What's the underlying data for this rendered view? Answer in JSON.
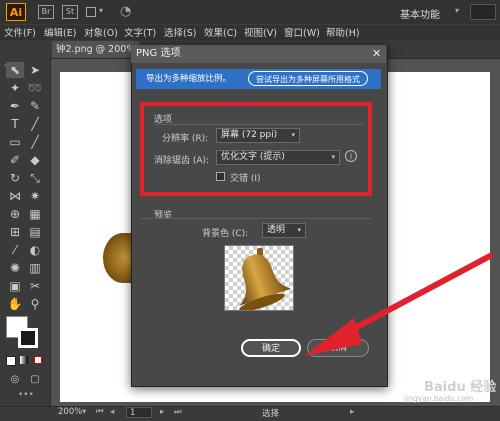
{
  "app": {
    "logo_text": "Ai",
    "bar_icons": [
      "Br",
      "St"
    ],
    "workspace_label": "基本功能",
    "colors": {
      "accent": "#ff9a00",
      "info_bar": "#2e72c8",
      "highlight": "#e0222c",
      "arrow": "#e0222c"
    }
  },
  "menu": {
    "items": [
      "文件(F)",
      "编辑(E)",
      "对象(O)",
      "文字(T)",
      "选择(S)",
      "效果(C)",
      "视图(V)",
      "窗口(W)",
      "帮助(H)"
    ]
  },
  "document": {
    "tab_label": "钟2.png @ 200%"
  },
  "dialog": {
    "title": "PNG 选项",
    "info_text": "导出为多种缩放比例。",
    "info_button": "尝试导出为多种屏幕所用格式",
    "options_group": "选项",
    "resolution_label": "分辨率 (R):",
    "resolution_value": "屏幕 (72 ppi)",
    "antialias_label": "消除锯齿 (A):",
    "antialias_value": "优化文字 (提示)",
    "interlace_label": "交错 (I)",
    "interlace_checked": false,
    "preview_group": "预览",
    "bg_label": "背景色 (C):",
    "bg_value": "透明",
    "ok": "确定",
    "cancel": "取消"
  },
  "status": {
    "zoom": "200%",
    "page": "1",
    "tool": "选择"
  },
  "watermark": {
    "text": "Baidu 经验",
    "url": "jingyan.baidu.com"
  },
  "icons": [
    "selection-tool-icon",
    "direct-selection-icon",
    "magic-wand-icon",
    "lasso-icon",
    "pen-icon",
    "type-icon",
    "line-icon",
    "rectangle-icon",
    "paintbrush-icon",
    "pencil-icon",
    "eraser-icon",
    "rotate-icon",
    "scale-icon",
    "width-icon",
    "shape-builder-icon",
    "perspective-icon",
    "mesh-icon",
    "gradient-icon",
    "eyedropper-icon",
    "blend-icon",
    "symbol-sprayer-icon",
    "column-graph-icon",
    "artboard-icon",
    "slice-icon",
    "hand-icon",
    "zoom-icon"
  ]
}
